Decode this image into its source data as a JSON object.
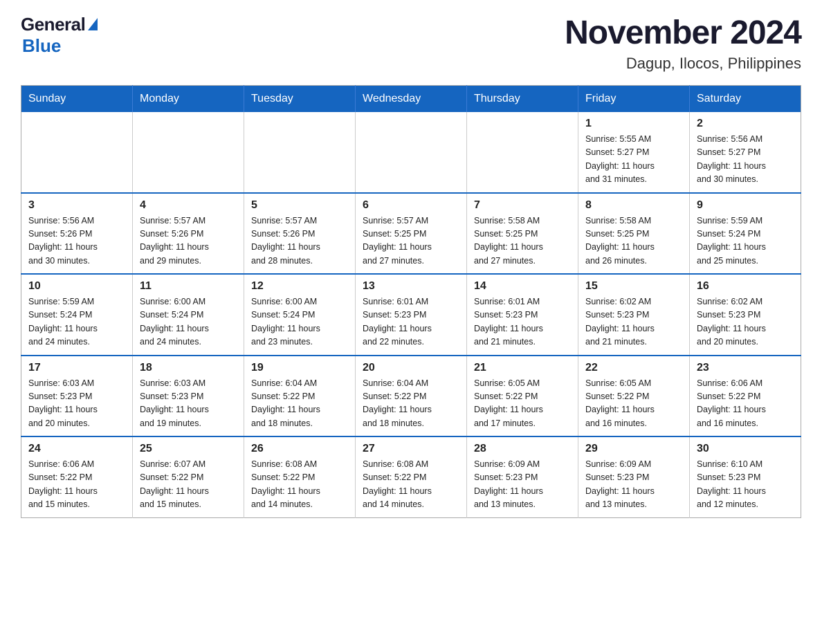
{
  "logo": {
    "general": "General",
    "blue": "Blue"
  },
  "title": "November 2024",
  "subtitle": "Dagup, Ilocos, Philippines",
  "days_of_week": [
    "Sunday",
    "Monday",
    "Tuesday",
    "Wednesday",
    "Thursday",
    "Friday",
    "Saturday"
  ],
  "weeks": [
    {
      "days": [
        {
          "number": "",
          "info": ""
        },
        {
          "number": "",
          "info": ""
        },
        {
          "number": "",
          "info": ""
        },
        {
          "number": "",
          "info": ""
        },
        {
          "number": "",
          "info": ""
        },
        {
          "number": "1",
          "info": "Sunrise: 5:55 AM\nSunset: 5:27 PM\nDaylight: 11 hours\nand 31 minutes."
        },
        {
          "number": "2",
          "info": "Sunrise: 5:56 AM\nSunset: 5:27 PM\nDaylight: 11 hours\nand 30 minutes."
        }
      ]
    },
    {
      "days": [
        {
          "number": "3",
          "info": "Sunrise: 5:56 AM\nSunset: 5:26 PM\nDaylight: 11 hours\nand 30 minutes."
        },
        {
          "number": "4",
          "info": "Sunrise: 5:57 AM\nSunset: 5:26 PM\nDaylight: 11 hours\nand 29 minutes."
        },
        {
          "number": "5",
          "info": "Sunrise: 5:57 AM\nSunset: 5:26 PM\nDaylight: 11 hours\nand 28 minutes."
        },
        {
          "number": "6",
          "info": "Sunrise: 5:57 AM\nSunset: 5:25 PM\nDaylight: 11 hours\nand 27 minutes."
        },
        {
          "number": "7",
          "info": "Sunrise: 5:58 AM\nSunset: 5:25 PM\nDaylight: 11 hours\nand 27 minutes."
        },
        {
          "number": "8",
          "info": "Sunrise: 5:58 AM\nSunset: 5:25 PM\nDaylight: 11 hours\nand 26 minutes."
        },
        {
          "number": "9",
          "info": "Sunrise: 5:59 AM\nSunset: 5:24 PM\nDaylight: 11 hours\nand 25 minutes."
        }
      ]
    },
    {
      "days": [
        {
          "number": "10",
          "info": "Sunrise: 5:59 AM\nSunset: 5:24 PM\nDaylight: 11 hours\nand 24 minutes."
        },
        {
          "number": "11",
          "info": "Sunrise: 6:00 AM\nSunset: 5:24 PM\nDaylight: 11 hours\nand 24 minutes."
        },
        {
          "number": "12",
          "info": "Sunrise: 6:00 AM\nSunset: 5:24 PM\nDaylight: 11 hours\nand 23 minutes."
        },
        {
          "number": "13",
          "info": "Sunrise: 6:01 AM\nSunset: 5:23 PM\nDaylight: 11 hours\nand 22 minutes."
        },
        {
          "number": "14",
          "info": "Sunrise: 6:01 AM\nSunset: 5:23 PM\nDaylight: 11 hours\nand 21 minutes."
        },
        {
          "number": "15",
          "info": "Sunrise: 6:02 AM\nSunset: 5:23 PM\nDaylight: 11 hours\nand 21 minutes."
        },
        {
          "number": "16",
          "info": "Sunrise: 6:02 AM\nSunset: 5:23 PM\nDaylight: 11 hours\nand 20 minutes."
        }
      ]
    },
    {
      "days": [
        {
          "number": "17",
          "info": "Sunrise: 6:03 AM\nSunset: 5:23 PM\nDaylight: 11 hours\nand 20 minutes."
        },
        {
          "number": "18",
          "info": "Sunrise: 6:03 AM\nSunset: 5:23 PM\nDaylight: 11 hours\nand 19 minutes."
        },
        {
          "number": "19",
          "info": "Sunrise: 6:04 AM\nSunset: 5:22 PM\nDaylight: 11 hours\nand 18 minutes."
        },
        {
          "number": "20",
          "info": "Sunrise: 6:04 AM\nSunset: 5:22 PM\nDaylight: 11 hours\nand 18 minutes."
        },
        {
          "number": "21",
          "info": "Sunrise: 6:05 AM\nSunset: 5:22 PM\nDaylight: 11 hours\nand 17 minutes."
        },
        {
          "number": "22",
          "info": "Sunrise: 6:05 AM\nSunset: 5:22 PM\nDaylight: 11 hours\nand 16 minutes."
        },
        {
          "number": "23",
          "info": "Sunrise: 6:06 AM\nSunset: 5:22 PM\nDaylight: 11 hours\nand 16 minutes."
        }
      ]
    },
    {
      "days": [
        {
          "number": "24",
          "info": "Sunrise: 6:06 AM\nSunset: 5:22 PM\nDaylight: 11 hours\nand 15 minutes."
        },
        {
          "number": "25",
          "info": "Sunrise: 6:07 AM\nSunset: 5:22 PM\nDaylight: 11 hours\nand 15 minutes."
        },
        {
          "number": "26",
          "info": "Sunrise: 6:08 AM\nSunset: 5:22 PM\nDaylight: 11 hours\nand 14 minutes."
        },
        {
          "number": "27",
          "info": "Sunrise: 6:08 AM\nSunset: 5:22 PM\nDaylight: 11 hours\nand 14 minutes."
        },
        {
          "number": "28",
          "info": "Sunrise: 6:09 AM\nSunset: 5:23 PM\nDaylight: 11 hours\nand 13 minutes."
        },
        {
          "number": "29",
          "info": "Sunrise: 6:09 AM\nSunset: 5:23 PM\nDaylight: 11 hours\nand 13 minutes."
        },
        {
          "number": "30",
          "info": "Sunrise: 6:10 AM\nSunset: 5:23 PM\nDaylight: 11 hours\nand 12 minutes."
        }
      ]
    }
  ]
}
